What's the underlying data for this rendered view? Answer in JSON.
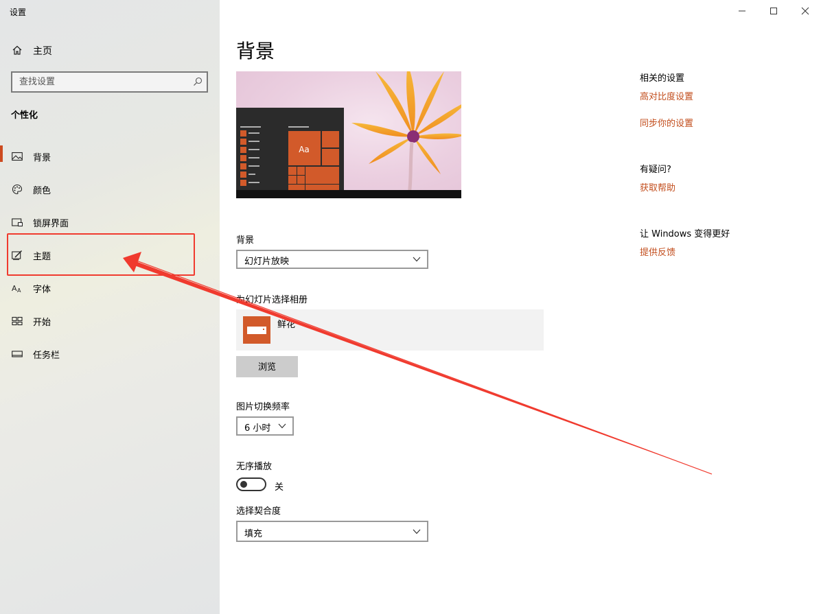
{
  "window": {
    "title": "设置"
  },
  "sidebar": {
    "home_label": "主页",
    "search_placeholder": "查找设置",
    "section_title": "个性化",
    "items": [
      {
        "label": "背景",
        "icon": "image-icon",
        "active": true
      },
      {
        "label": "颜色",
        "icon": "palette-icon"
      },
      {
        "label": "锁屏界面",
        "icon": "lock-screen-icon"
      },
      {
        "label": "主题",
        "icon": "theme-icon"
      },
      {
        "label": "字体",
        "icon": "font-icon"
      },
      {
        "label": "开始",
        "icon": "start-icon"
      },
      {
        "label": "任务栏",
        "icon": "taskbar-icon"
      }
    ]
  },
  "main": {
    "title": "背景",
    "preview_tile_label": "Aa",
    "background_label": "背景",
    "background_value": "幻灯片放映",
    "album_label": "为幻灯片选择相册",
    "album_name": "鲜花",
    "browse_label": "浏览",
    "interval_label": "图片切换频率",
    "interval_value": "6 小时",
    "shuffle_label": "无序播放",
    "shuffle_state": "关",
    "fit_label": "选择契合度",
    "fit_value": "填充"
  },
  "related": {
    "heading": "相关的设置",
    "links": [
      "高对比度设置",
      "同步你的设置"
    ],
    "help_heading": "有疑问?",
    "help_link": "获取帮助",
    "feedback_heading": "让 Windows 变得更好",
    "feedback_link": "提供反馈"
  },
  "colors": {
    "accent": "#cc4a1f",
    "link": "#c24d1c",
    "annotation": "#f03a2e"
  }
}
